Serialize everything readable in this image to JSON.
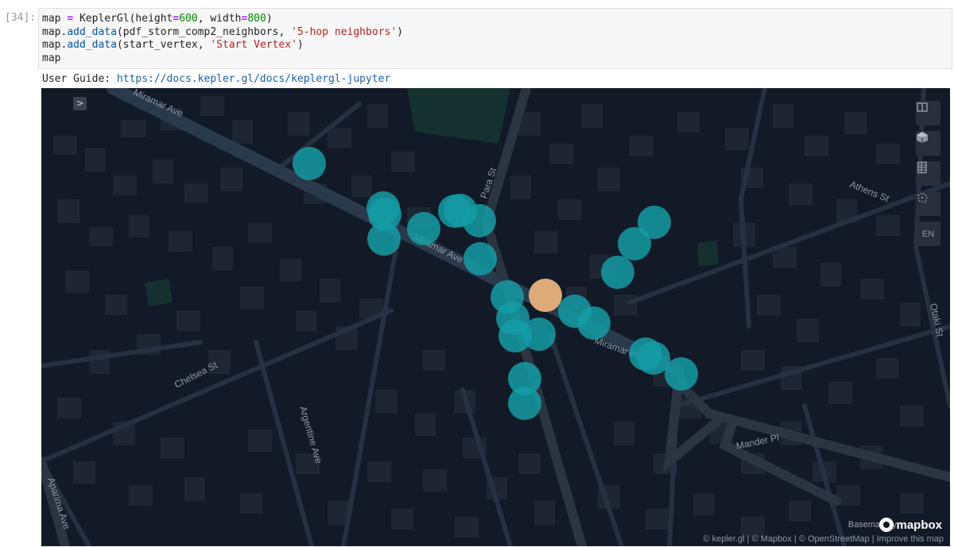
{
  "cell": {
    "prompt": "[34]:",
    "line1": {
      "var": "map",
      "op": "=",
      "fn": "KeplerGl",
      "arg1": "height",
      "val1": "600",
      "arg2": "width",
      "val2": "800"
    },
    "line2": {
      "obj": "map",
      "method": "add_data",
      "arg": "pdf_storm_comp2_neighbors",
      "label": "'5-hop neighbors'"
    },
    "line3": {
      "obj": "map",
      "method": "add_data",
      "arg": "start_vertex",
      "label": "'Start Vertex'"
    },
    "line4": "map"
  },
  "guide": {
    "label": "User Guide: ",
    "url": "https://docs.kepler.gl/docs/keplergl-jupyter"
  },
  "map": {
    "toggle_glyph": ">",
    "controls": [
      {
        "name": "split-map-control",
        "icon": "split-map-icon"
      },
      {
        "name": "3d-map-control",
        "icon": "cube-icon"
      },
      {
        "name": "data-table-control",
        "icon": "table-icon"
      },
      {
        "name": "draw-control",
        "icon": "polygon-draw-icon"
      },
      {
        "name": "locale-control",
        "text": "EN"
      }
    ],
    "streets": {
      "miramar_top": "Miramar Ave",
      "miramar_mid": "Miramar Ave",
      "miramar_lower": "Miramar Ave",
      "para": "Para St",
      "athens": "Athens St",
      "chelsea": "Chelsea St",
      "argentine": "Argentine Ave",
      "mander": "Mander Pl",
      "otaki": "Otaki St",
      "aparima": "Aparima Ave"
    },
    "layers": {
      "neighbors": {
        "name": "5-hop neighbors",
        "color": "#149ca4"
      },
      "start": {
        "name": "Start Vertex",
        "color": "#dcab78"
      }
    },
    "basemap_label": "Basemap by:",
    "mapbox_label": "mapbox",
    "attribution": "© kepler.gl | © Mapbox | © OpenStreetMap | Improve this map"
  }
}
